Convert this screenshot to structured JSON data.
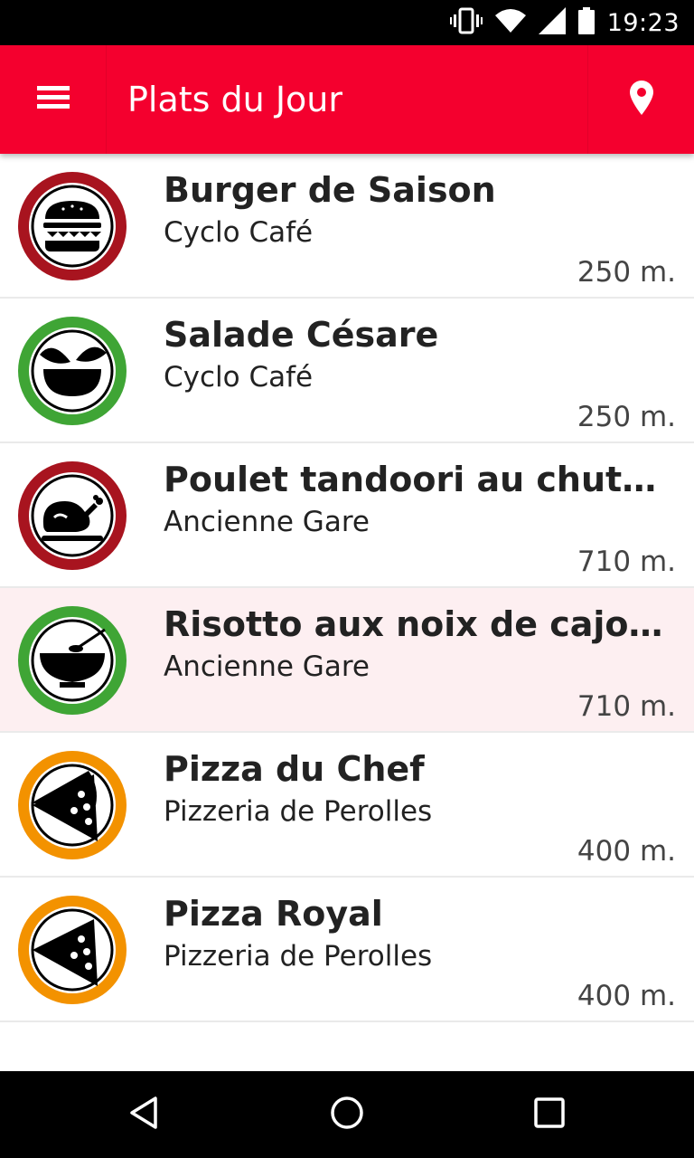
{
  "status_bar": {
    "time": "19:23",
    "icons": [
      "vibrate-icon",
      "wifi-icon",
      "cell-signal-icon",
      "battery-icon"
    ]
  },
  "app_bar": {
    "title": "Plats du Jour",
    "menu_icon": "hamburger-menu-icon",
    "location_icon": "location-pin-icon",
    "color": "#f4002e"
  },
  "dishes": [
    {
      "name": "Burger de Saison",
      "restaurant": "Cyclo Café",
      "distance": "250 m.",
      "icon": "burger-icon",
      "ring_color": "#a8141f",
      "highlighted": false
    },
    {
      "name": "Salade Césare",
      "restaurant": "Cyclo Café",
      "distance": "250 m.",
      "icon": "salad-icon",
      "ring_color": "#3fa535",
      "highlighted": false
    },
    {
      "name": "Poulet tandoori au chutney",
      "restaurant": "Ancienne Gare",
      "distance": "710 m.",
      "icon": "roast-chicken-icon",
      "ring_color": "#a8141f",
      "highlighted": false
    },
    {
      "name": "Risotto aux noix de cajou et légumes",
      "restaurant": "Ancienne Gare",
      "distance": "710 m.",
      "icon": "soup-bowl-icon",
      "ring_color": "#3fa535",
      "highlighted": true
    },
    {
      "name": "Pizza du Chef",
      "restaurant": "Pizzeria de Perolles",
      "distance": "400 m.",
      "icon": "pizza-slice-icon",
      "ring_color": "#f39200",
      "highlighted": false
    },
    {
      "name": "Pizza Royal",
      "restaurant": "Pizzeria de Perolles",
      "distance": "400 m.",
      "icon": "pizza-slice-icon",
      "ring_color": "#f39200",
      "highlighted": false
    }
  ],
  "nav_bar": {
    "icons": [
      "back-triangle-icon",
      "home-circle-icon",
      "recents-square-icon"
    ]
  }
}
